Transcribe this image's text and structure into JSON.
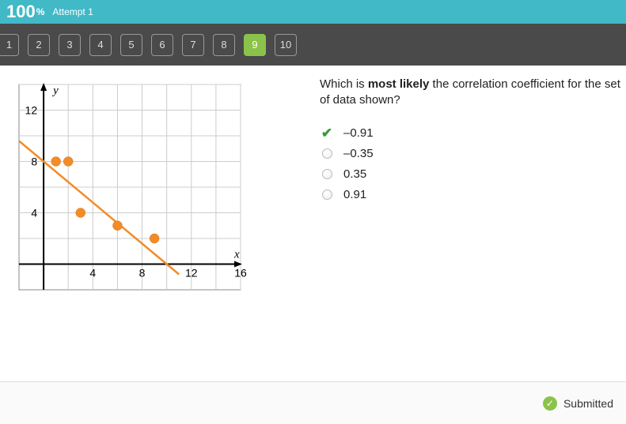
{
  "header": {
    "score": "100",
    "pct": "%",
    "attempt_label": "Attempt 1"
  },
  "nav": {
    "items": [
      "1",
      "2",
      "3",
      "4",
      "5",
      "6",
      "7",
      "8",
      "9",
      "10"
    ],
    "active_index": 8
  },
  "question": {
    "prefix": "Which is ",
    "bold": "most likely",
    "suffix": " the correlation coefficient for the set of data shown?"
  },
  "options": [
    {
      "label": "–0.91",
      "state": "correct-selected"
    },
    {
      "label": "–0.35",
      "state": "unselected"
    },
    {
      "label": "0.35",
      "state": "unselected"
    },
    {
      "label": "0.91",
      "state": "unselected"
    }
  ],
  "footer": {
    "submitted_label": "Submitted"
  },
  "chart_data": {
    "type": "scatter",
    "title": "",
    "xlabel": "x",
    "ylabel": "y",
    "xlim": [
      -2,
      16
    ],
    "ylim": [
      -2,
      14
    ],
    "x_ticks": [
      4,
      8,
      12,
      16
    ],
    "y_ticks": [
      4,
      8,
      12
    ],
    "grid": true,
    "points": [
      {
        "x": 1,
        "y": 8
      },
      {
        "x": 2,
        "y": 8
      },
      {
        "x": 3,
        "y": 4
      },
      {
        "x": 6,
        "y": 3
      },
      {
        "x": 9,
        "y": 2
      }
    ],
    "fit_line": {
      "x1": -2,
      "y1": 9.6,
      "x2": 11,
      "y2": -0.8
    }
  }
}
